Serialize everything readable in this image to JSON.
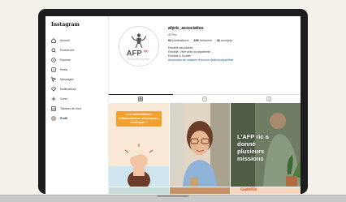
{
  "sidebar": {
    "logo": "Instagram",
    "items": [
      {
        "label": "Accueil",
        "icon": "home-icon"
      },
      {
        "label": "Recherche",
        "icon": "search-icon"
      },
      {
        "label": "Explorer",
        "icon": "compass-icon"
      },
      {
        "label": "Reels",
        "icon": "reels-icon"
      },
      {
        "label": "Messages",
        "icon": "messenger-icon"
      },
      {
        "label": "Notifications",
        "icon": "heart-icon"
      },
      {
        "label": "Créer",
        "icon": "plus-icon"
      },
      {
        "label": "Tableau de bord",
        "icon": "dashboard-icon"
      },
      {
        "label": "Profil",
        "icon": "avatar-icon"
      }
    ]
  },
  "profile": {
    "username": "afpric_associatios",
    "fullname": "AFPric",
    "stats": {
      "posts": "62",
      "posts_label": "publications",
      "followers": "166",
      "followers_label": "followers",
      "following": "41",
      "following_label": "suivi(e)s"
    },
    "bio": [
      "Entraide associative",
      "Entraide, Vivre avec la polyarthrite, ...",
      "Entraide & Soutien",
      "Association de malades reconnue @afpricpolyarthrite"
    ]
  },
  "tabs": [
    "grid-icon",
    "reels-icon",
    "tagged-icon"
  ],
  "posts": [
    {
      "text": "Les rhumatismes inflammatoires chroniques, c'est quoi ?"
    },
    {
      "text": ""
    },
    {
      "text": "L'AFP ric a donné plusieurs missions"
    },
    {
      "text": ""
    },
    {
      "text": ""
    },
    {
      "text": "Galette"
    }
  ],
  "colors": {
    "accent": "#f2a12e",
    "frame": "#1d1d1f",
    "link": "#27598c"
  }
}
